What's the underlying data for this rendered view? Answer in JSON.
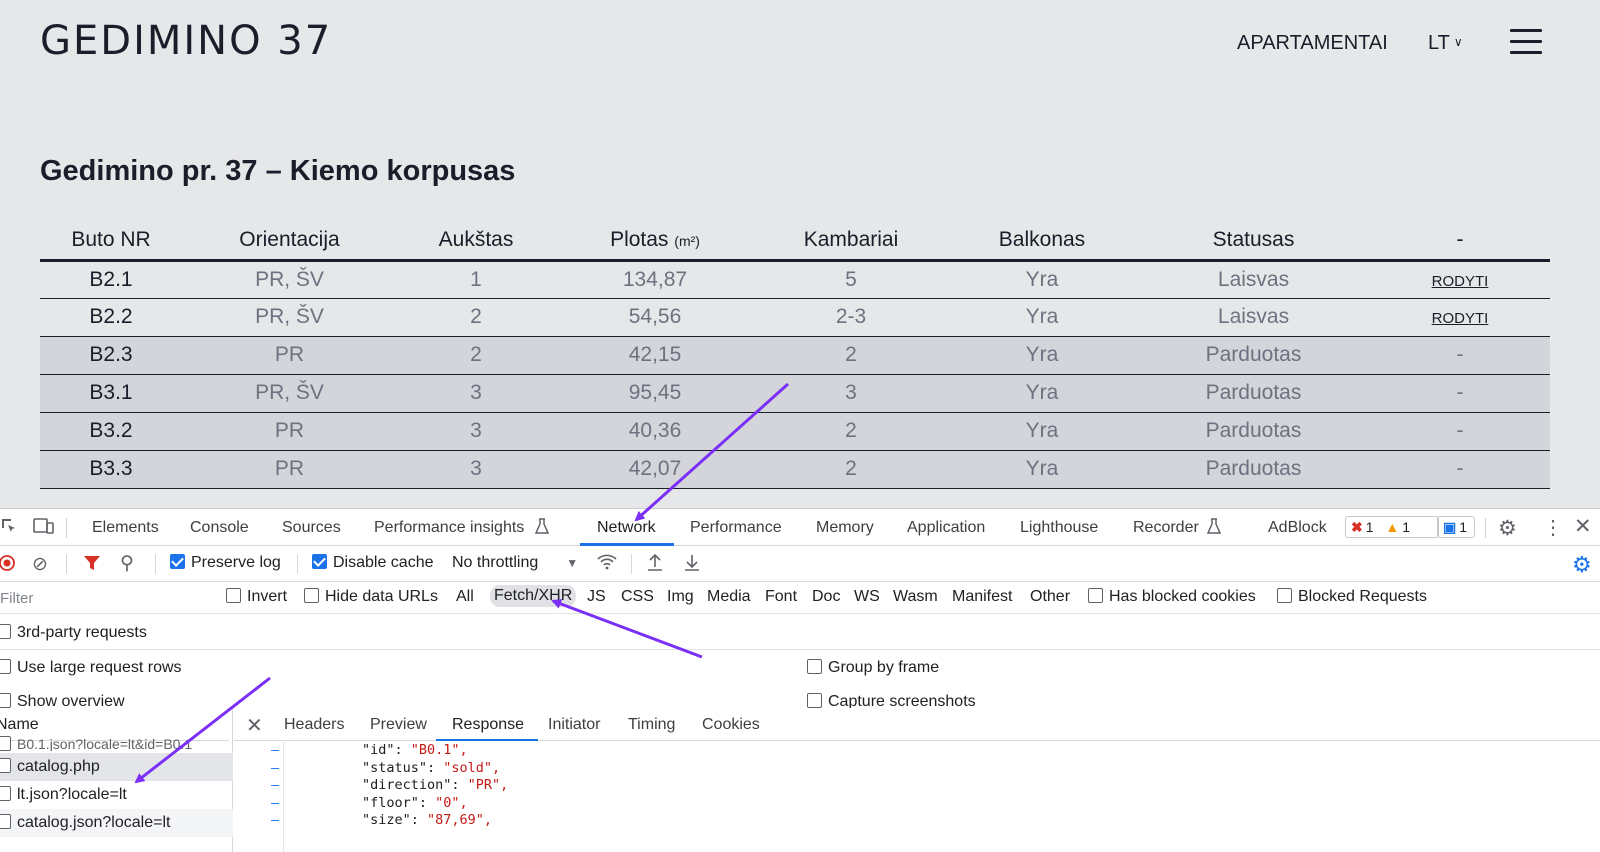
{
  "site": {
    "logo": "GEDIMINO 37",
    "nav_link": "APARTAMENTAI",
    "lang": "LT",
    "section_title": "Gedimino pr. 37 – Kiemo korpusas",
    "table": {
      "headers": [
        "Buto NR",
        "Orientacija",
        "Aukštas",
        "Plotas",
        "Kambariai",
        "Balkonas",
        "Statusas",
        "-"
      ],
      "area_unit": "(m²)",
      "rows": [
        {
          "nr": "B2.1",
          "orient": "PR, ŠV",
          "floor": "1",
          "area": "134,87",
          "rooms": "5",
          "balcony": "Yra",
          "status": "Laisvas",
          "action": "RODYTI",
          "sold": false
        },
        {
          "nr": "B2.2",
          "orient": "PR, ŠV",
          "floor": "2",
          "area": "54,56",
          "rooms": "2-3",
          "balcony": "Yra",
          "status": "Laisvas",
          "action": "RODYTI",
          "sold": false
        },
        {
          "nr": "B2.3",
          "orient": "PR",
          "floor": "2",
          "area": "42,15",
          "rooms": "2",
          "balcony": "Yra",
          "status": "Parduotas",
          "action": "-",
          "sold": true
        },
        {
          "nr": "B3.1",
          "orient": "PR, ŠV",
          "floor": "3",
          "area": "95,45",
          "rooms": "3",
          "balcony": "Yra",
          "status": "Parduotas",
          "action": "-",
          "sold": true
        },
        {
          "nr": "B3.2",
          "orient": "PR",
          "floor": "3",
          "area": "40,36",
          "rooms": "2",
          "balcony": "Yra",
          "status": "Parduotas",
          "action": "-",
          "sold": true
        },
        {
          "nr": "B3.3",
          "orient": "PR",
          "floor": "3",
          "area": "42,07",
          "rooms": "2",
          "balcony": "Yra",
          "status": "Parduotas",
          "action": "-",
          "sold": true
        }
      ]
    }
  },
  "devtools": {
    "tabs": [
      "Elements",
      "Console",
      "Sources",
      "Performance insights",
      "Network",
      "Performance",
      "Memory",
      "Application",
      "Lighthouse",
      "Recorder",
      "AdBlock"
    ],
    "active_tab": "Network",
    "badges": {
      "errors": "1",
      "warnings": "1",
      "messages": "1"
    },
    "toolbar": {
      "preserve_log": "Preserve log",
      "disable_cache": "Disable cache",
      "throttling": "No throttling"
    },
    "filter": {
      "placeholder": "Filter",
      "invert": "Invert",
      "hide_data_urls": "Hide data URLs",
      "types": [
        "All",
        "Fetch/XHR",
        "JS",
        "CSS",
        "Img",
        "Media",
        "Font",
        "Doc",
        "WS",
        "Wasm",
        "Manifest",
        "Other"
      ],
      "selected_type": "Fetch/XHR",
      "has_blocked_cookies": "Has blocked cookies",
      "blocked_requests": "Blocked Requests"
    },
    "options": {
      "third_party": "3rd-party requests",
      "large_rows": "Use large request rows",
      "show_overview": "Show overview",
      "group_by_frame": "Group by frame",
      "capture_screenshots": "Capture screenshots"
    },
    "requests": {
      "header": "Name",
      "items": [
        "B0.1.json?locale=lt&id=B0.1",
        "catalog.php",
        "lt.json?locale=lt",
        "catalog.json?locale=lt"
      ]
    },
    "detail_tabs": [
      "Headers",
      "Preview",
      "Response",
      "Initiator",
      "Timing",
      "Cookies"
    ],
    "active_detail_tab": "Response",
    "response_lines": [
      {
        "key": "\"id\": ",
        "val": "\"B0.1\","
      },
      {
        "key": "\"status\": ",
        "val": "\"sold\","
      },
      {
        "key": "\"direction\": ",
        "val": "\"PR\","
      },
      {
        "key": "\"floor\": ",
        "val": "\"0\","
      },
      {
        "key": "\"size\": ",
        "val": "\"87,69\","
      }
    ],
    "colors": {
      "accent": "#1a73e8",
      "annotation_arrow": "#7b2ff7",
      "string": "#c41a16"
    }
  }
}
